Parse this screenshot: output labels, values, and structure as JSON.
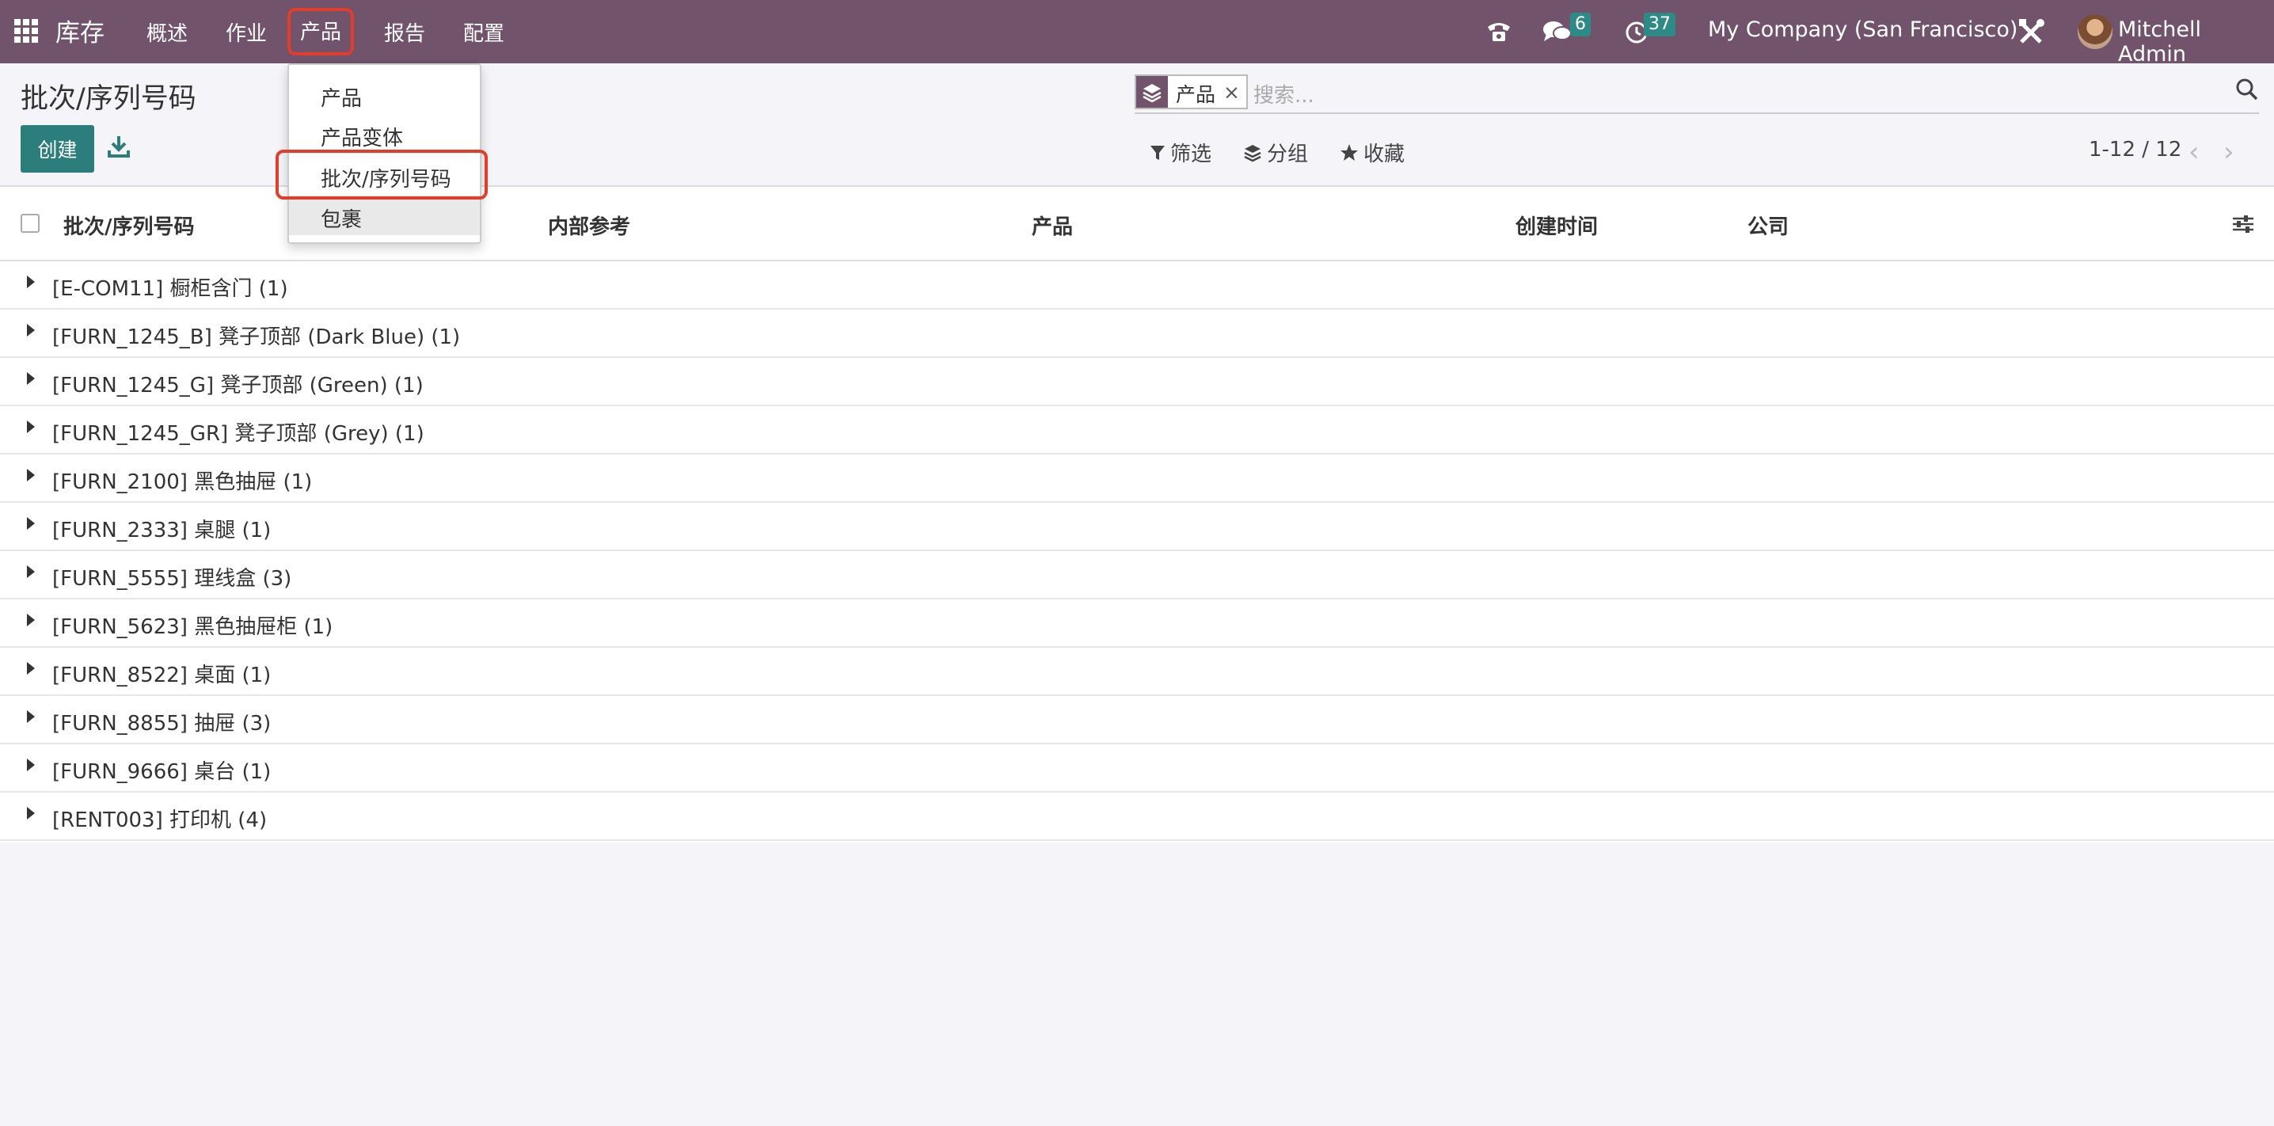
{
  "navbar": {
    "app_name": "库存",
    "menu": [
      "概述",
      "作业",
      "产品",
      "报告",
      "配置"
    ],
    "messages_count": "6",
    "activities_count": "37",
    "company": "My Company (San Francisco)",
    "user": "Mitchell Admin"
  },
  "page": {
    "title": "批次/序列号码",
    "create_label": "创建"
  },
  "search": {
    "facet_value": "产品",
    "facet_close": "×",
    "placeholder": "搜索..."
  },
  "filters": {
    "filter_label": "筛选",
    "group_label": "分组",
    "favorites_label": "收藏"
  },
  "pager": {
    "value": "1-12 / 12"
  },
  "list": {
    "columns": [
      "批次/序列号码",
      "内部参考",
      "产品",
      "创建时间",
      "公司"
    ],
    "groups": [
      "[E-COM11] 橱柜含门 (1)",
      "[FURN_1245_B] 凳子顶部 (Dark Blue) (1)",
      "[FURN_1245_G] 凳子顶部 (Green) (1)",
      "[FURN_1245_GR] 凳子顶部 (Grey) (1)",
      "[FURN_2100] 黑色抽屉 (1)",
      "[FURN_2333] 桌腿 (1)",
      "[FURN_5555] 理线盒 (3)",
      "[FURN_5623] 黑色抽屉柜 (1)",
      "[FURN_8522] 桌面 (1)",
      "[FURN_8855] 抽屉 (3)",
      "[FURN_9666] 桌台 (1)",
      "[RENT003] 打印机 (4)"
    ]
  },
  "dropdown": {
    "items": [
      "产品",
      "产品变体",
      "批次/序列号码",
      "包裹"
    ]
  },
  "colors": {
    "navbar": "#71536c",
    "primary_button": "#2b7e7b",
    "badge": "#2d8a86",
    "highlight_box": "#e23c2a"
  }
}
